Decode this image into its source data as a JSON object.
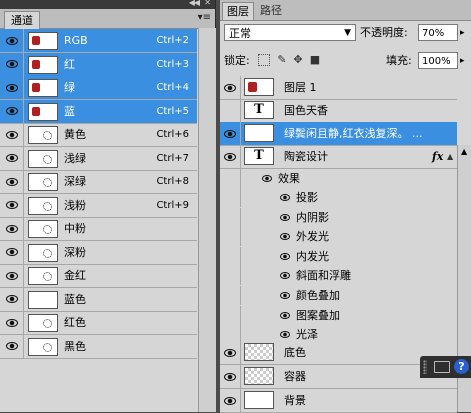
{
  "channels_panel": {
    "tab": "通道",
    "rows": [
      {
        "name": "RGB",
        "shortcut": "Ctrl+2",
        "selected": true,
        "visible": true,
        "thumb": "rgb"
      },
      {
        "name": "红",
        "shortcut": "Ctrl+3",
        "selected": true,
        "visible": true,
        "thumb": "rgb"
      },
      {
        "name": "绿",
        "shortcut": "Ctrl+4",
        "selected": true,
        "visible": true,
        "thumb": "rgb"
      },
      {
        "name": "蓝",
        "shortcut": "Ctrl+5",
        "selected": true,
        "visible": true,
        "thumb": "rgb"
      },
      {
        "name": "黄色",
        "shortcut": "Ctrl+6",
        "selected": false,
        "visible": true,
        "thumb": "mask"
      },
      {
        "name": "浅绿",
        "shortcut": "Ctrl+7",
        "selected": false,
        "visible": true,
        "thumb": "mask"
      },
      {
        "name": "深绿",
        "shortcut": "Ctrl+8",
        "selected": false,
        "visible": true,
        "thumb": "mask"
      },
      {
        "name": "浅粉",
        "shortcut": "Ctrl+9",
        "selected": false,
        "visible": true,
        "thumb": "mask"
      },
      {
        "name": "中粉",
        "shortcut": "",
        "selected": false,
        "visible": true,
        "thumb": "mask"
      },
      {
        "name": "深粉",
        "shortcut": "",
        "selected": false,
        "visible": true,
        "thumb": "mask"
      },
      {
        "name": "金红",
        "shortcut": "",
        "selected": false,
        "visible": true,
        "thumb": "mask"
      },
      {
        "name": "蓝色",
        "shortcut": "",
        "selected": false,
        "visible": true,
        "thumb": "blank"
      },
      {
        "name": "红色",
        "shortcut": "",
        "selected": false,
        "visible": true,
        "thumb": "mask"
      },
      {
        "name": "黑色",
        "shortcut": "",
        "selected": false,
        "visible": true,
        "thumb": "mask"
      }
    ]
  },
  "layers_panel": {
    "tabs": [
      "图层",
      "路径"
    ],
    "blend_mode": "正常",
    "opacity_label": "不透明度:",
    "opacity_value": "70%",
    "lock_label": "锁定:",
    "fill_label": "填充:",
    "fill_value": "100%",
    "layers": [
      {
        "name": "图层 1",
        "type": "image",
        "selected": false,
        "visible": true
      },
      {
        "name": "国色天香",
        "type": "text",
        "selected": false,
        "visible": false
      },
      {
        "name": "绿鬓闲且静,红衣浅复深。 ...",
        "type": "text",
        "selected": true,
        "visible": true
      },
      {
        "name": "陶瓷设计",
        "type": "text",
        "selected": false,
        "visible": true,
        "fx": "fx"
      }
    ],
    "effects_header": "效果",
    "effects": [
      "投影",
      "内阴影",
      "外发光",
      "内发光",
      "斜面和浮雕",
      "颜色叠加",
      "图案叠加",
      "光泽"
    ],
    "bottom_layers": [
      {
        "name": "底色",
        "type": "checker",
        "visible": true
      },
      {
        "name": "容器",
        "type": "checker",
        "visible": true
      },
      {
        "name": "背景",
        "type": "blank",
        "visible": true
      }
    ]
  }
}
